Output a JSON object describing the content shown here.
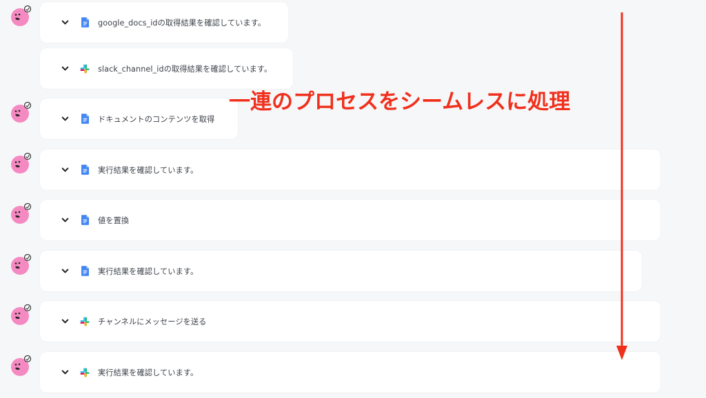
{
  "annotation": {
    "text": "一連のプロセスをシームレスに処理",
    "color": "#f0301c"
  },
  "colors": {
    "background": "#f6f7f9",
    "card": "#ffffff",
    "text": "#3c4148",
    "avatar": "#f58ac2"
  },
  "steps": [
    {
      "icon": "google-docs-icon",
      "label": "google_docs_idの取得結果を確認しています。",
      "has_avatar": true
    },
    {
      "icon": "slack-icon",
      "label": "slack_channel_idの取得結果を確認しています。",
      "has_avatar": false
    },
    {
      "icon": "google-docs-icon",
      "label": "ドキュメントのコンテンツを取得",
      "has_avatar": true
    },
    {
      "icon": "google-docs-icon",
      "label": "実行結果を確認しています。",
      "has_avatar": true
    },
    {
      "icon": "google-docs-icon",
      "label": "値を置換",
      "has_avatar": true
    },
    {
      "icon": "google-docs-icon",
      "label": "実行結果を確認しています。",
      "has_avatar": true
    },
    {
      "icon": "slack-icon",
      "label": "チャンネルにメッセージを送る",
      "has_avatar": true
    },
    {
      "icon": "slack-icon",
      "label": "実行結果を確認しています。",
      "has_avatar": true
    }
  ]
}
